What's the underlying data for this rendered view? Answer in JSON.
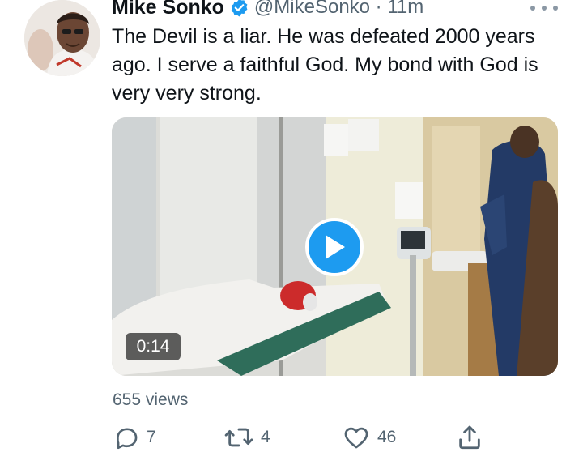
{
  "tweet": {
    "author_name": "Mike Sonko",
    "handle_line": "@MikeSonko · 11m",
    "text": "The Devil is a liar. He was defeated 2000 years ago. I serve a faithful God. My bond with God is very very strong.",
    "verified": true,
    "accent_color": "#1d9bf0"
  },
  "media": {
    "type": "video",
    "duration": "0:14",
    "play_icon": "play-icon"
  },
  "stats": {
    "views": "655 views"
  },
  "actions": {
    "reply_count": "7",
    "retweet_count": "4",
    "like_count": "46",
    "icons": [
      "reply-icon",
      "retweet-icon",
      "like-icon",
      "share-icon"
    ]
  }
}
